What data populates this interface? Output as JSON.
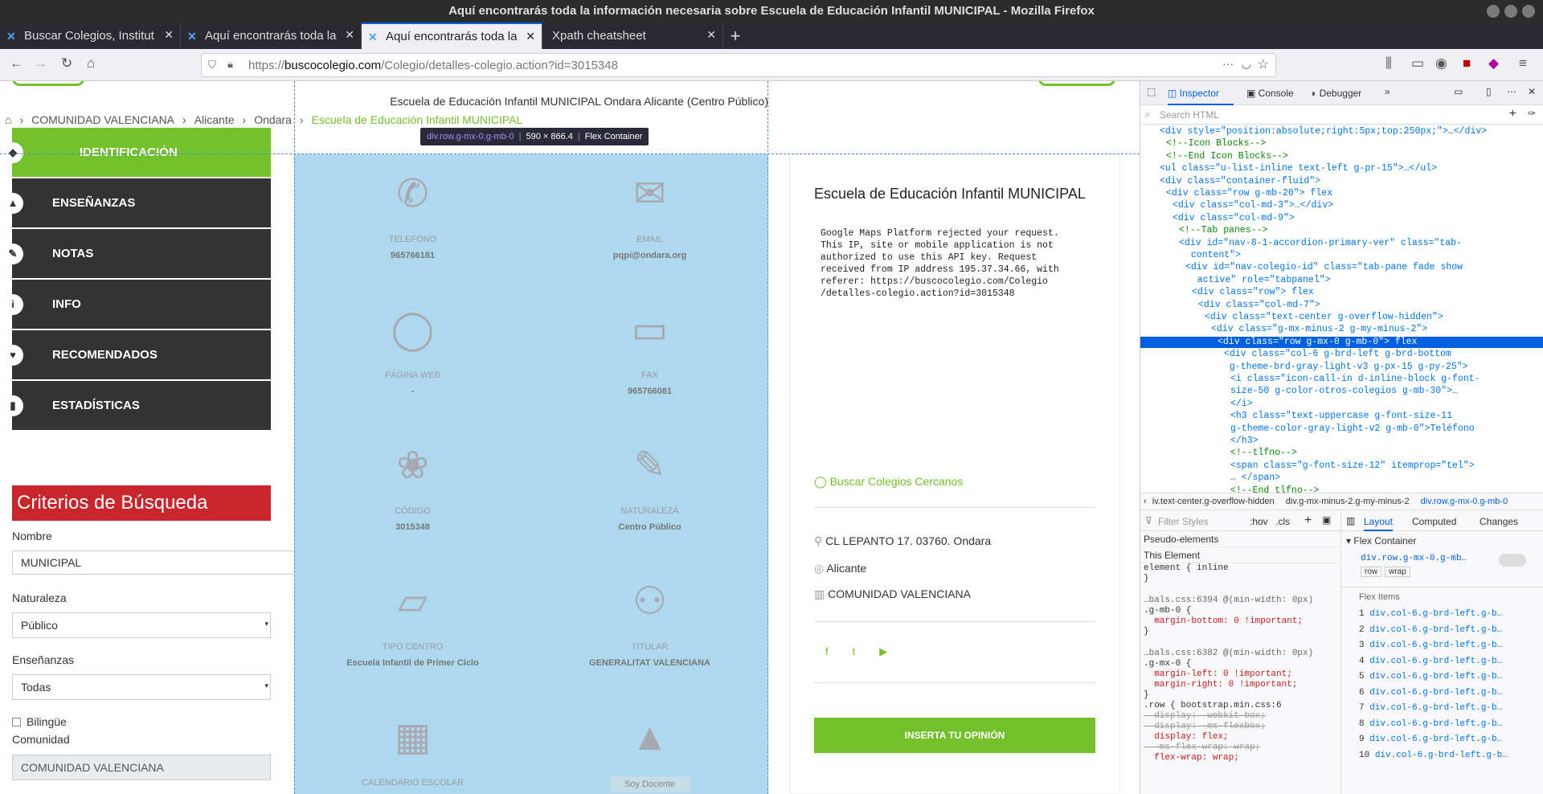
{
  "window": {
    "title": "Aquí encontrarás toda la información necesaria sobre Escuela de Educación Infantil MUNICIPAL - Mozilla Firefox"
  },
  "tabs": [
    {
      "label": "Buscar Colegios, Institut"
    },
    {
      "label": "Aquí encontrarás toda la"
    },
    {
      "label": "Aquí encontrarás toda la"
    },
    {
      "label": "Xpath cheatsheet"
    }
  ],
  "url": {
    "prefix": "https://",
    "domain": "buscocolegio.com",
    "path": "/Colegio/detalles-colegio.action?id=3015348"
  },
  "header": {
    "title": "Escuela de Educación Infantil MUNICIPAL Ondara Alicante (Centro Público)"
  },
  "breadcrumb": [
    "COMUNIDAD VALENCIANA",
    "Alicante",
    "Ondara",
    "Escuela de Educación Infantil MUNICIPAL"
  ],
  "tooltip": {
    "selector": "div.row.g-mx-0.g-mb-0",
    "size": "590 × 866.4",
    "type": "Flex Container"
  },
  "sidebar": [
    {
      "label": "IDENTIFICACIÓN",
      "icon": "tag-icon"
    },
    {
      "label": "ENSEÑANZAS",
      "icon": "graduation-icon"
    },
    {
      "label": "NOTAS",
      "icon": "edit-icon"
    },
    {
      "label": "INFO",
      "icon": "info-icon"
    },
    {
      "label": "RECOMENDADOS",
      "icon": "heart-icon"
    },
    {
      "label": "ESTADÍSTICAS",
      "icon": "chart-icon"
    }
  ],
  "search": {
    "title": "Criterios de Búsqueda",
    "nombre_label": "Nombre",
    "nombre_value": "MUNICIPAL",
    "naturaleza_label": "Naturaleza",
    "naturaleza_value": "Público",
    "ensenanzas_label": "Enseñanzas",
    "ensenanzas_value": "Todas",
    "bilingue_label": "Bilingüe",
    "comunidad_label": "Comunidad",
    "comunidad_value": "COMUNIDAD VALENCIANA"
  },
  "info_cells": [
    {
      "label": "TELEFONO",
      "value": "965766181",
      "icon": "phone-icon"
    },
    {
      "label": "EMAIL",
      "value": "pqpi@ondara.org",
      "icon": "email-icon"
    },
    {
      "label": "PÁGINA WEB",
      "value": "-",
      "icon": "globe-icon"
    },
    {
      "label": "FAX",
      "value": "965766081",
      "icon": "printer-icon"
    },
    {
      "label": "CÓDIGO",
      "value": "3015348",
      "icon": "award-icon"
    },
    {
      "label": "NATURALEZA",
      "value": "Centro Público",
      "icon": "pin-icon"
    },
    {
      "label": "TIPO CENTRO",
      "value": "Escuela Infantil de Primer Ciclo",
      "icon": "folder-icon"
    },
    {
      "label": "TITULAR",
      "value": "GENERALITAT VALENCIANA",
      "icon": "user-icon"
    },
    {
      "label": "CALENDARIO ESCOLAR",
      "value": "",
      "icon": "calendar-icon"
    },
    {
      "label": "",
      "value": "Soy Docente",
      "icon": "graduation-cap-icon"
    }
  ],
  "card": {
    "title": "Escuela de Educación Infantil MUNICIPAL",
    "maps_error": "Google Maps Platform rejected your request.\nThis IP, site or mobile application is not\nauthorized to use this API key. Request\nreceived from IP address 195.37.34.66, with\nreferer: https://buscocolegio.com/Colegio\n/detalles-colegio.action?id=3015348",
    "nearby": "Buscar Colegios Cercanos",
    "address": "CL LEPANTO 17. 03760. Ondara",
    "province": "Alicante",
    "community": "COMUNIDAD VALENCIANA",
    "opinion_button": "INSERTA TU OPINIÓN"
  },
  "devtools": {
    "tabs": [
      "Inspector",
      "Console",
      "Debugger"
    ],
    "search_placeholder": "Search HTML",
    "html_lines": [
      {
        "indent": 2,
        "text": "<div style=\"position:absolute;right:5px;top:250px;\">…</div>",
        "type": "tag"
      },
      {
        "indent": 3,
        "text": "<!--Icon Blocks-->",
        "type": "cm"
      },
      {
        "indent": 3,
        "text": "<!--End Icon Blocks-->",
        "type": "cm"
      },
      {
        "indent": 2,
        "text": "<ul class=\"u-list-inline text-left g-pr-15\">…</ul>",
        "type": "tag"
      },
      {
        "indent": 2,
        "text": "<div class=\"container-fluid\">",
        "type": "tag"
      },
      {
        "indent": 3,
        "text": "<div class=\"row g-mb-20\"> flex",
        "type": "tag"
      },
      {
        "indent": 4,
        "text": "<div class=\"col-md-3\">…</div>",
        "type": "tag"
      },
      {
        "indent": 4,
        "text": "<div class=\"col-md-9\">",
        "type": "tag"
      },
      {
        "indent": 5,
        "text": "<!--Tab panes-->",
        "type": "cm"
      },
      {
        "indent": 5,
        "text": "<div id=\"nav-8-1-accordion-primary-ver\" class=\"tab-",
        "type": "tag"
      },
      {
        "indent": 6,
        "text": " content\">",
        "type": "tag"
      },
      {
        "indent": 6,
        "text": "<div id=\"nav-colegio-id\" class=\"tab-pane fade show",
        "type": "tag"
      },
      {
        "indent": 7,
        "text": " active\" role=\"tabpanel\">",
        "type": "tag"
      },
      {
        "indent": 7,
        "text": "<div class=\"row\"> flex",
        "type": "tag"
      },
      {
        "indent": 8,
        "text": "<div class=\"col-md-7\">",
        "type": "tag"
      },
      {
        "indent": 9,
        "text": "<div class=\"text-center g-overflow-hidden\">",
        "type": "tag"
      },
      {
        "indent": 10,
        "text": "<div class=\"g-mx-minus-2 g-my-minus-2\">",
        "type": "tag"
      },
      {
        "indent": 11,
        "text": "<div class=\"row g-mx-0 g-mb-0\"> flex",
        "type": "sel"
      },
      {
        "indent": 12,
        "text": "<div class=\"col-6 g-brd-left g-brd-bottom",
        "type": "tag"
      },
      {
        "indent": 12,
        "text": " g-theme-brd-gray-light-v3 g-px-15 g-py-25\">",
        "type": "tag"
      },
      {
        "indent": 13,
        "text": "<i class=\"icon-call-in d-inline-block g-font-",
        "type": "tag"
      },
      {
        "indent": 13,
        "text": "size-50 g-color-otros-colegios g-mb-30\">…",
        "type": "tag"
      },
      {
        "indent": 13,
        "text": "</i>",
        "type": "tag"
      },
      {
        "indent": 13,
        "text": "<h3 class=\"text-uppercase g-font-size-11",
        "type": "tag"
      },
      {
        "indent": 13,
        "text": "g-theme-color-gray-light-v2 g-mb-0\">Teléfono",
        "type": "tag"
      },
      {
        "indent": 13,
        "text": "</h3>",
        "type": "tag"
      },
      {
        "indent": 13,
        "text": "<!--tlfno-->",
        "type": "cm"
      },
      {
        "indent": 13,
        "text": "<span class=\"g-font-size-12\" itemprop=\"tel\">",
        "type": "tag"
      },
      {
        "indent": 13,
        "text": "… </span>",
        "type": "tag"
      },
      {
        "indent": 13,
        "text": "<!--End tlfno-->",
        "type": "cm"
      }
    ],
    "crumbs": [
      "iv.text-center.g-overflow-hidden",
      "div.g-mx-minus-2.g-my-minus-2",
      "div.row.g-mx-0.g-mb-0"
    ],
    "filter_placeholder": "Filter Styles",
    "rule_tabs": [
      "Layout",
      "Computed",
      "Changes"
    ],
    "styles": [
      {
        "text": "Pseudo-elements",
        "type": "head"
      },
      {
        "text": "This Element",
        "type": "head"
      },
      {
        "text": "element { inline",
        "type": "rule"
      },
      {
        "text": "}",
        "type": "rule"
      },
      {
        "text": "…bals.css:6394 @(min-width: 0px)",
        "type": "src"
      },
      {
        "text": ".g-mb-0 {",
        "type": "rule"
      },
      {
        "text": "  margin-bottom: 0 !important;",
        "type": "prop"
      },
      {
        "text": "}",
        "type": "rule"
      },
      {
        "text": "…bals.css:6382 @(min-width: 0px)",
        "type": "src"
      },
      {
        "text": ".g-mx-0 {",
        "type": "rule"
      },
      {
        "text": "  margin-left: 0 !important;",
        "type": "prop"
      },
      {
        "text": "  margin-right: 0 !important;",
        "type": "prop"
      },
      {
        "text": "}",
        "type": "rule"
      },
      {
        "text": ".row { bootstrap.min.css:6",
        "type": "rule"
      },
      {
        "text": "  display: -webkit-box;",
        "type": "strike"
      },
      {
        "text": "  display: -ms-flexbox;",
        "type": "strike"
      },
      {
        "text": "  display: flex;",
        "type": "prop"
      },
      {
        "text": "  -ms-flex-wrap: wrap;",
        "type": "strike"
      },
      {
        "text": "  flex-wrap: wrap;",
        "type": "prop"
      }
    ],
    "layout": {
      "title": "Flex Container",
      "selector": "div.row.g-mx-0.g-mb…",
      "tags": [
        "row",
        "wrap"
      ],
      "items_title": "Flex Items",
      "items": [
        "1",
        "2",
        "3",
        "4",
        "5",
        "6",
        "7",
        "8",
        "9",
        "10"
      ],
      "item_text": "div.col-6.g-brd-left.g-b…"
    }
  }
}
